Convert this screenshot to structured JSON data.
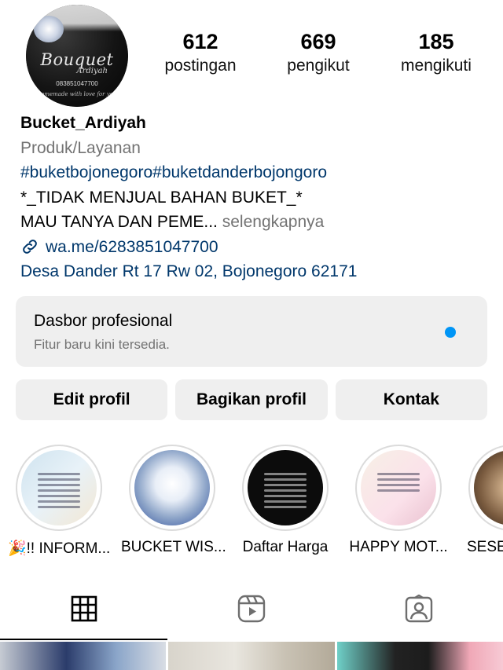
{
  "profile": {
    "username": "Bucket_Ardiyah",
    "category": "Produk/Layanan",
    "hashtags": "#buketbojonegoro#buketdanderbojongoro",
    "bio_line1": "*_TIDAK MENJUAL BAHAN BUKET_*",
    "bio_line2": "MAU TANYA DAN PEME...",
    "more_label": "selengkapnya",
    "link": "wa.me/6283851047700",
    "address": "Desa Dander Rt 17 Rw 02, Bojonegoro 62171",
    "avatar": {
      "logo_text": "Bouquet",
      "sub_text": "Ardiyah",
      "phone": "083851047700",
      "tagline": "homemade with love for you"
    }
  },
  "stats": [
    {
      "value": "612",
      "label": "postingan"
    },
    {
      "value": "669",
      "label": "pengikut"
    },
    {
      "value": "185",
      "label": "mengikuti"
    }
  ],
  "dashboard": {
    "title": "Dasbor profesional",
    "subtitle": "Fitur baru kini tersedia.",
    "dot_color": "#0095f6"
  },
  "buttons": {
    "edit": "Edit profil",
    "share": "Bagikan profil",
    "contact": "Kontak"
  },
  "highlights": [
    {
      "label": "🎉!! INFORM...",
      "icon": "info-highlight"
    },
    {
      "label": "BUCKET WIS...",
      "icon": "bucket-highlight"
    },
    {
      "label": "Daftar Harga",
      "icon": "price-list-highlight"
    },
    {
      "label": "HAPPY MOT...",
      "icon": "happy-highlight"
    },
    {
      "label": "SESE",
      "icon": "sese-highlight"
    }
  ],
  "tabs": [
    {
      "name": "grid-icon",
      "active": true
    },
    {
      "name": "reels-icon",
      "active": false
    },
    {
      "name": "tagged-icon",
      "active": false
    }
  ],
  "colors": {
    "link": "#00376b",
    "muted": "#737373",
    "button_bg": "#efefef",
    "accent": "#0095f6"
  }
}
